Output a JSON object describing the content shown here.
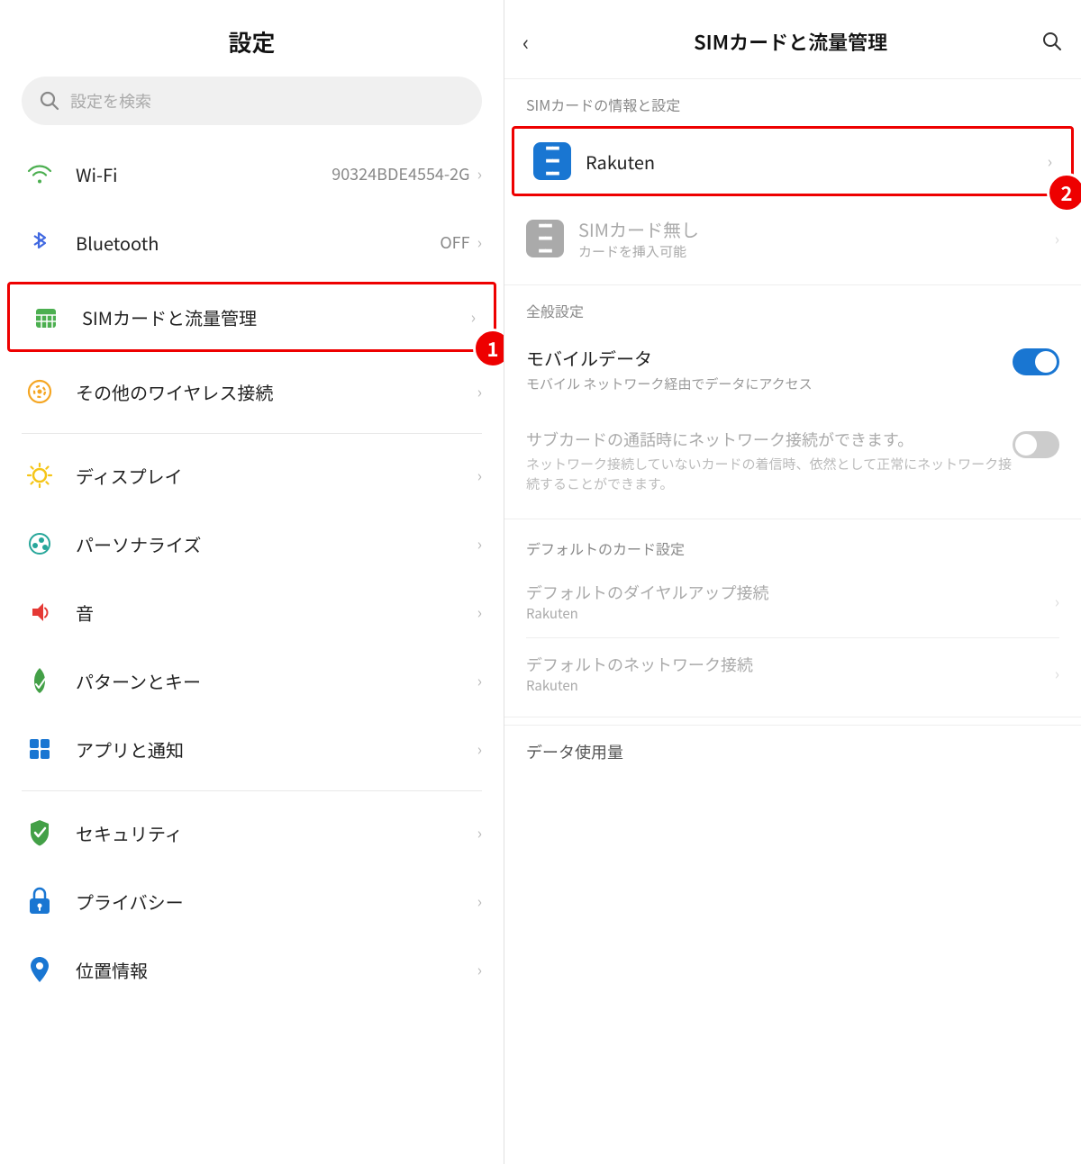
{
  "left": {
    "title": "設定",
    "search": {
      "placeholder": "設定を検索"
    },
    "items": [
      {
        "id": "wifi",
        "label": "Wi-Fi",
        "value": "90324BDE4554-2G",
        "icon": "wifi"
      },
      {
        "id": "bluetooth",
        "label": "Bluetooth",
        "value": "OFF",
        "icon": "bluetooth"
      },
      {
        "id": "sim",
        "label": "SIMカードと流量管理",
        "value": "",
        "icon": "sim",
        "highlighted": true,
        "badge": "1"
      },
      {
        "id": "wireless",
        "label": "その他のワイヤレス接続",
        "value": "",
        "icon": "wireless"
      },
      {
        "id": "display",
        "label": "ディスプレイ",
        "value": "",
        "icon": "display"
      },
      {
        "id": "personalize",
        "label": "パーソナライズ",
        "value": "",
        "icon": "personalize"
      },
      {
        "id": "sound",
        "label": "音",
        "value": "",
        "icon": "sound"
      },
      {
        "id": "pattern",
        "label": "パターンとキー",
        "value": "",
        "icon": "pattern"
      },
      {
        "id": "apps",
        "label": "アプリと通知",
        "value": "",
        "icon": "apps"
      },
      {
        "id": "security",
        "label": "セキュリティ",
        "value": "",
        "icon": "security"
      },
      {
        "id": "privacy",
        "label": "プライバシー",
        "value": "",
        "icon": "privacy"
      },
      {
        "id": "location",
        "label": "位置情報",
        "value": "",
        "icon": "location"
      }
    ]
  },
  "right": {
    "title": "SIMカードと流量管理",
    "back": "‹",
    "section_sim": "SIMカードの情報と設定",
    "sim_slots": [
      {
        "id": "sim1",
        "name": "Rakuten",
        "sub": "",
        "color": "blue",
        "num": "1",
        "highlighted": true,
        "badge": "2"
      },
      {
        "id": "sim2",
        "name": "SIMカード無し",
        "sub": "カードを挿入可能",
        "color": "green",
        "num": "2",
        "highlighted": false
      }
    ],
    "section_general": "全般設定",
    "mobile_data": {
      "title": "モバイルデータ",
      "desc": "モバイル ネットワーク経由でデータにアクセス",
      "toggle": "on"
    },
    "sub_card": {
      "title": "サブカードの通話時にネットワーク接続ができます。",
      "desc": "ネットワーク接続していないカードの着信時、依然として正常にネットワーク接続することができます。",
      "toggle": "off"
    },
    "section_defaults": "デフォルトのカード設定",
    "default_dialup": {
      "title": "デフォルトのダイヤルアップ接続",
      "sub": "Rakuten"
    },
    "default_network": {
      "title": "デフォルトのネットワーク接続",
      "sub": "Rakuten"
    },
    "data_usage_label": "データ使用量"
  }
}
